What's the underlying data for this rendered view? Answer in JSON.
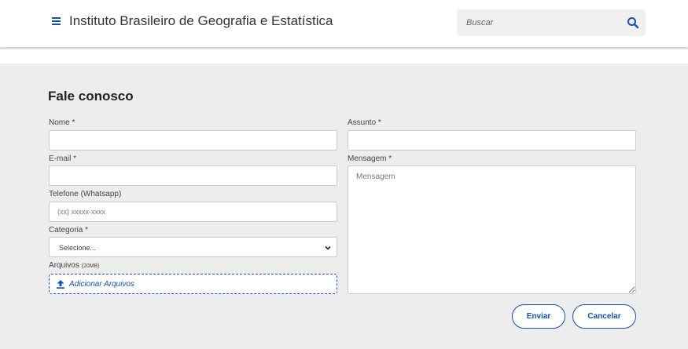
{
  "header": {
    "site_title": "Instituto Brasileiro de Geografia e Estatística",
    "search": {
      "placeholder": "Buscar"
    },
    "icons": {
      "menu": "hamburger-icon",
      "search": "search-icon"
    }
  },
  "form": {
    "title": "Fale conosco",
    "fields": {
      "nome": {
        "label": "Nome *",
        "value": ""
      },
      "email": {
        "label": "E-mail *",
        "value": ""
      },
      "telefone": {
        "label": "Telefone (Whatsapp)",
        "placeholder": "(xx) xxxxx-xxxx"
      },
      "categoria": {
        "label": "Categoria *",
        "selected": "Selecione..."
      },
      "arquivos": {
        "label": "Arquivos",
        "limit": "(20MB)",
        "button": "Adicionar Arquivos"
      },
      "assunto": {
        "label": "Assunto *",
        "value": ""
      },
      "mensagem": {
        "label": "Mensagem *",
        "placeholder": "Mensagem"
      }
    },
    "buttons": {
      "enviar": "Enviar",
      "cancelar": "Cancelar"
    }
  },
  "colors": {
    "accent": "#1351b4",
    "background": "#ededed"
  }
}
